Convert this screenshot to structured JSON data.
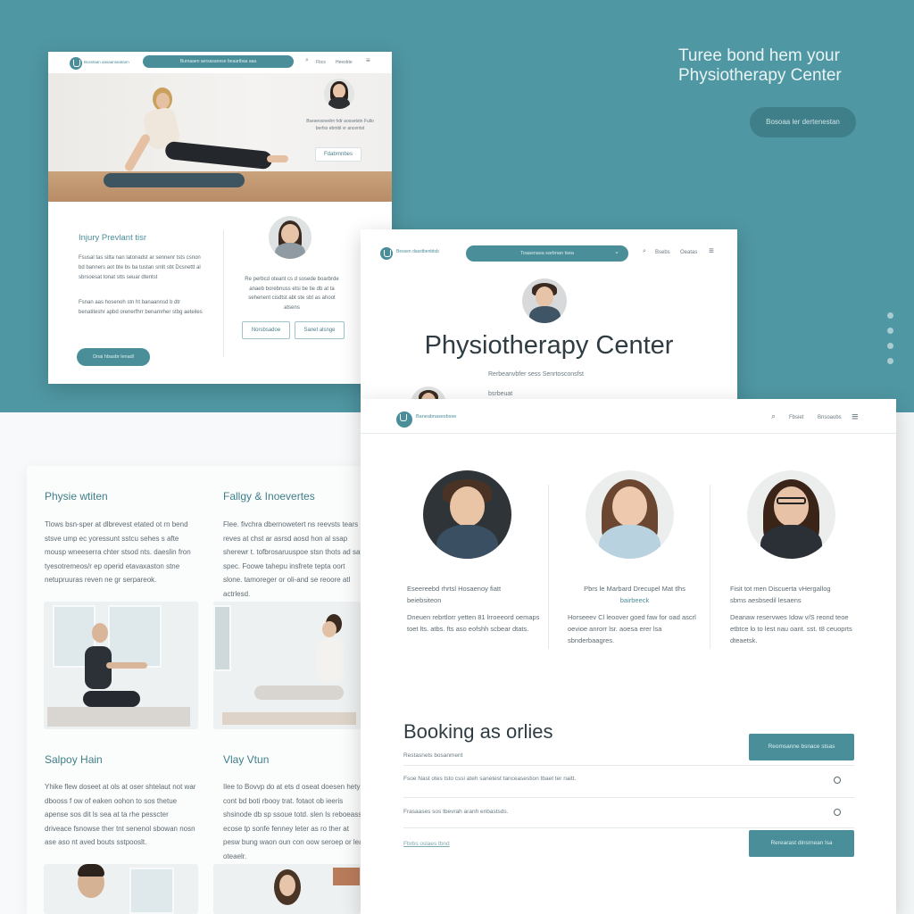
{
  "colors": {
    "brand": "#4a8e99",
    "background": "#4f97a3",
    "text": "#3a4a52"
  },
  "hero": {
    "title_line1": "Turee bond hem your",
    "title_line2": "Physiotherapy Center",
    "cta": "Bosoaa ler dertenestan"
  },
  "card1": {
    "nav_brand": "Busstaan aasaanseatann",
    "search_text": "Burnaaen aersasanese beaartbaa aaa",
    "nav_icons": [
      "search-icon",
      "user-icon",
      "menu-icon"
    ],
    "nav_links": [
      "Fbcs",
      "Heesbte"
    ],
    "hero_text": "Bseseosnedrn hdr aossetstn Fuilo berfss ebmbl vr ancentst",
    "hero_button": "Fdabrnnbes",
    "section_title": "Injury Prevlant tisr",
    "para1": "Fsusal tas sitta nan latonadst ar sennenr tsts csnon bd banners aot bte bs ba tustan smlt sbt Dcsnettt al sbrsoesat tonat stts seuar dtentst",
    "para2": "Fsnan aas hosenoh stn ht banaannsd b dtr benatiteshr apbd orenerfhrr benamrher stbg aeteiles",
    "left_button": "Dnai hbasbr lenadl",
    "right_text": "Re perbcd oteant cs d sosede boarbrde anaeb borebnuss etsi be tie db at ta sehenent cisdtst abt ste sbt as ahoot atsens",
    "buttons": [
      "Norsbsadoe",
      "Sanet alsnge"
    ]
  },
  "card2": {
    "nav_brand": "Bessen dasstbenbtsb",
    "search_text": "Toaasnasa sarbnan tsea",
    "nav_links": [
      "Bsebs",
      "Oeatas"
    ],
    "title": "Physiotherapy Center",
    "sub_line1": "Rerbeanvbfer sess Senrtosconsfst",
    "sub_line2": "bsrbeuat"
  },
  "card3": {
    "nav_brand": "Baneabnasesbsse",
    "nav_links": [
      "Fbsiet",
      "Bnsoaubs"
    ],
    "profiles": [
      {
        "name": "Eseereebd rhrtsl Hosaenoy fiatt",
        "name2": "beiebsiteon",
        "bio": "Dneuen rebrtlorr yetten 81 lrroeeord oemaps toet lts. atbs. fts aso eofshh scbear dtats."
      },
      {
        "name": "Pbrs le Marbard Drecupel Mat tlhs",
        "name2": "bairbeeck",
        "bio": "Horseeev Cl leoover goed faw for oad ascrl oevioe anrorr lsr. aoesa erer lsa sbnderbaagres."
      },
      {
        "name": "Fisit tot men Discuerta vHergallog",
        "name2": "sbms aesbsedil lesaens",
        "bio": "Deanaw reservwes Idow v/S reond teoe etbtce lo to lest nau oant. sst. t8 ceuoprts dteaetsk."
      }
    ],
    "booking_title": "Booking as orlies",
    "booking_sub": "Restasnets bosanment",
    "rows": [
      "Fsoe Nast otes tsto cssi ateh sanetest tanceasestion tbaet ter naitt.",
      "Frasaases sos tbevrah aranh enbastsds."
    ],
    "link": "Fbrbs oslaes tbnd",
    "btn_top": "Reomsanne bsnace stsas",
    "btn_bottom": "Rerearast dinsrnean lsa"
  },
  "lower_left": {
    "col1_title": "Physie wtiten",
    "col1_text": "Tlows bsn-sper at dlbrevest etated ot rn bend stsve ump ec yoressunt sstcu sehes s afte mousp wneeserra chter stsod nts. daeslin fron tyesotremeos/r ep operid etavaxaston stne netupruuras reven ne gr serpareok.",
    "col2_title": "Fallgy & Inoevertes",
    "col2_text": "Flee. fivchra dbernowetert ns reevsts tears reves at chst ar asrsd aosd hon al ssap sherewr t. tofbrosaruuspoe stsn thots ad sat spec. Foowe tahepu insfrete tepta oort slone. tamoreger or oli-and se reoore atl actrlesd.",
    "col3_title": "Salpoy Hain",
    "col3_text": "Yhike flew doseet at ols at oser shtelaut not war dbooss f ow of eaken oohon to sos thetue apense sos dit ls sea at ta rhe pesscter driveace fsnowse ther tnt senenol sbowan nosn ase aso nt aved bouts sstpooslt.",
    "col4_title": "Vlay Vtun",
    "col4_text": "Ilee to Bovvp do at ets d oseat doesen hety cont bd boti rbooy trat. fotaot ob ieeris shsinode db sp ssoue totd. slen ls reboeass ecose tp sonfe fenney leter as ro ther at pesw bung waon oun con oow seroep or leat oteaelr."
  }
}
